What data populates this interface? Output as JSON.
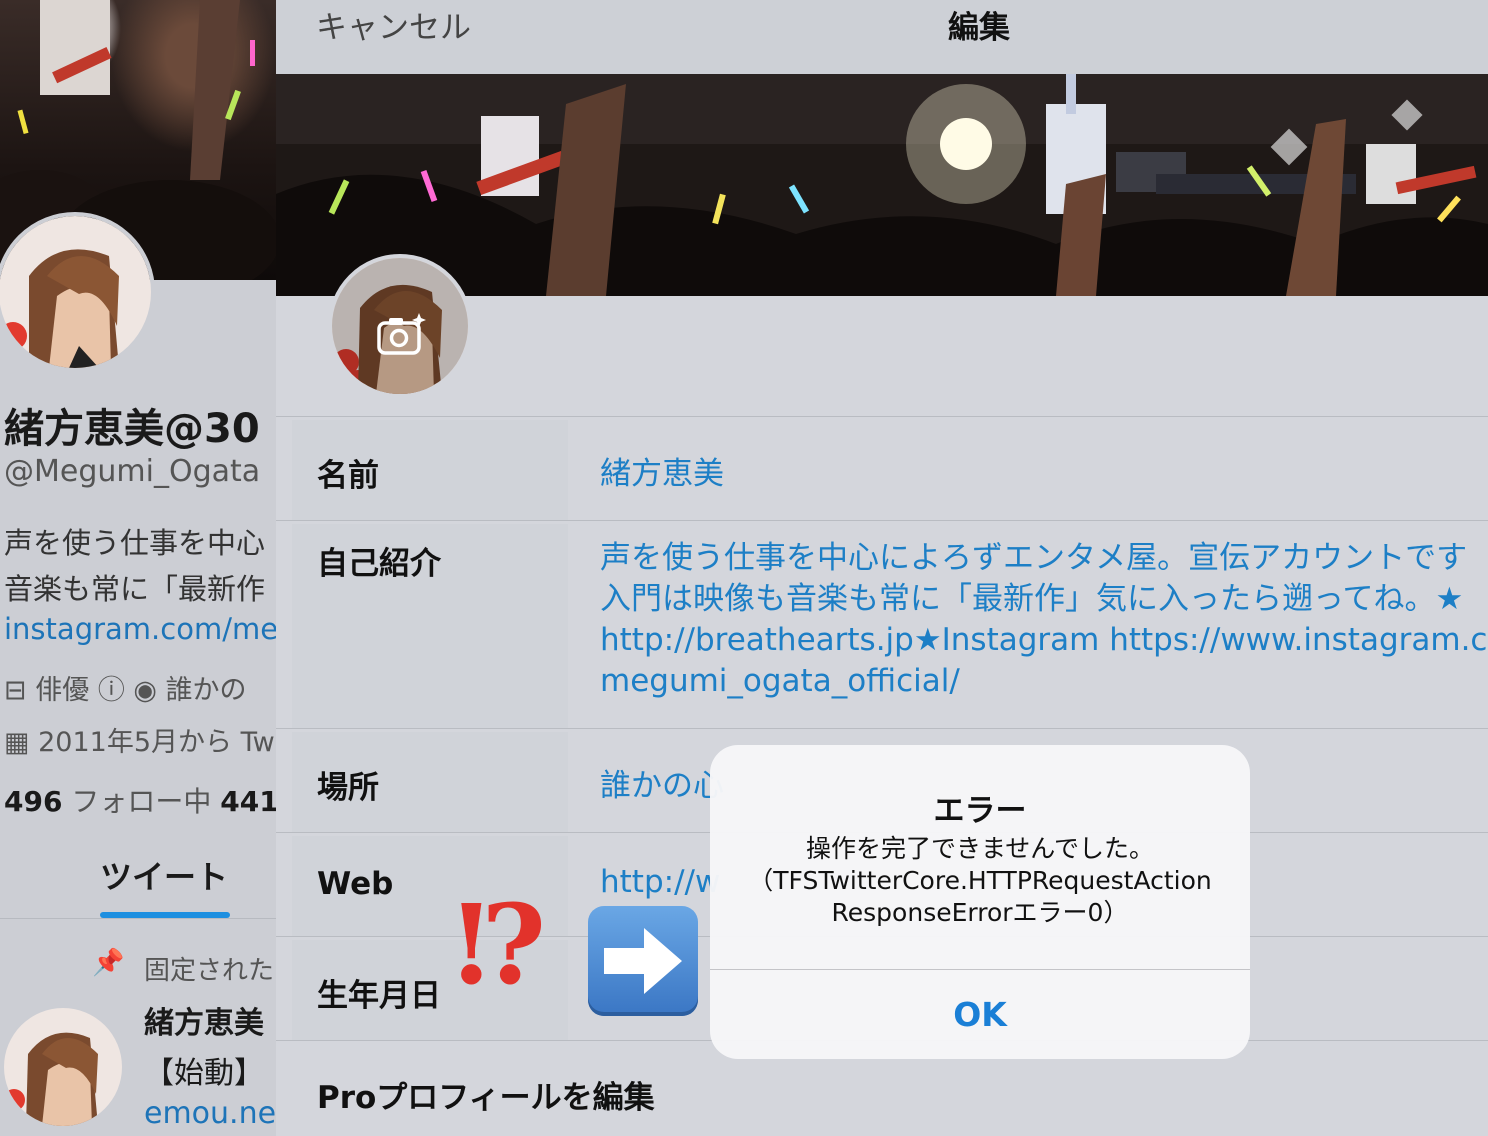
{
  "background_profile": {
    "display_name": "緒方恵美@30",
    "handle": "@Megumi_Ogata",
    "bio_lines": "声を使う仕事を中心\n音楽も常に「最新作",
    "link": "instagram.com/me",
    "job": "俳優",
    "location": "誰かの",
    "joined": "2011年5月から Tw",
    "following_count": "496",
    "following_label": "フォロー中",
    "followers_count": "441",
    "tab_tweets": "ツイート",
    "pinned_label": "固定された",
    "tweet_author": "緒方恵美",
    "tweet_text": "【始動】",
    "tweet_link": "emou.ne"
  },
  "nav": {
    "cancel": "キャンセル",
    "title": "編集"
  },
  "fields": {
    "name_label": "名前",
    "name_value": "緒方恵美",
    "bio_label": "自己紹介",
    "bio_value": "声を使う仕事を中心によろずエンタメ屋。宣伝アカウントです\n入門は映像も音楽も常に「最新作」気に入ったら遡ってね。★\nhttp://breathearts.jp★Instagram https://www.instagram.co\nmegumi_ogata_official/",
    "location_label": "場所",
    "location_value": "誰かの心",
    "web_label": "Web",
    "web_value": "http://w",
    "birthday_label": "生年月日",
    "pro_label": "Proプロフィールを編集"
  },
  "emoji": {
    "interrobang": "⁉",
    "arrow": "➡"
  },
  "alert": {
    "title": "エラー",
    "message": "操作を完了できませんでした。\n（TFSTwitterCore.HTTPRequestAction\nResponseErrorエラー0）",
    "ok": "OK"
  },
  "colors": {
    "link_blue": "#1d7fc6",
    "alert_button": "#1a7fd6",
    "tab_indicator": "#1d8fe0"
  }
}
